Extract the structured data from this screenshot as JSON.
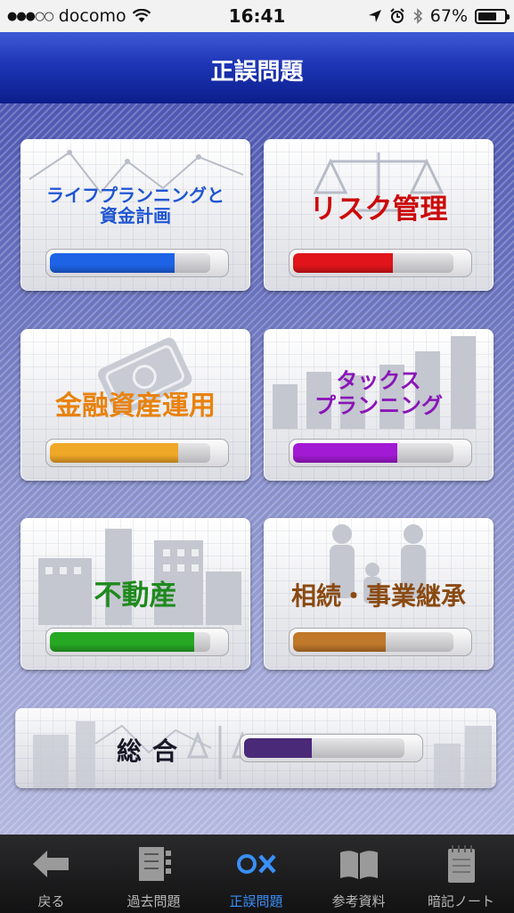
{
  "status_bar": {
    "carrier": "docomo",
    "time": "16:41",
    "battery": "67%",
    "icons": [
      "signal-dots-icon",
      "wifi-icon",
      "location-arrow-icon",
      "alarm-icon",
      "bluetooth-icon",
      "battery-icon"
    ]
  },
  "header": {
    "title": "正誤問題"
  },
  "categories": [
    {
      "label_line1": "ライフプランニングと",
      "label_line2": "資金計画",
      "color": "#1f55d2",
      "bar_color": "#1e63e6",
      "progress": 0.78
    },
    {
      "label_line1": "リスク管理",
      "label_line2": "",
      "color": "#cc0a0a",
      "bar_color": "#e0141a",
      "progress": 0.62
    },
    {
      "label_line1": "金融資産運用",
      "label_line2": "",
      "color": "#e8820e",
      "bar_color": "#f0a828",
      "progress": 0.8
    },
    {
      "label_line1": "タックス",
      "label_line2": "プランニング",
      "color": "#8a15b8",
      "bar_color": "#a21ad4",
      "progress": 0.65
    },
    {
      "label_line1": "不動産",
      "label_line2": "",
      "color": "#1e8a1c",
      "bar_color": "#26a824",
      "progress": 0.9
    },
    {
      "label_line1": "相続・事業継承",
      "label_line2": "",
      "color": "#8a4a12",
      "bar_color": "#c0782a",
      "progress": 0.58
    }
  ],
  "overall": {
    "label": "総合",
    "bar_color": "#4a2a78",
    "progress": 0.42
  },
  "tabs": [
    {
      "label": "戻る",
      "icon": "back-arrow-icon",
      "active": false
    },
    {
      "label": "過去問題",
      "icon": "book-list-icon",
      "active": false
    },
    {
      "label": "正誤問題",
      "icon": "circle-cross-icon",
      "active": true
    },
    {
      "label": "参考資料",
      "icon": "open-book-icon",
      "active": false
    },
    {
      "label": "暗記ノート",
      "icon": "notepad-icon",
      "active": false
    }
  ],
  "colors": {
    "header_blue": "#1e36b6",
    "tab_active": "#3a8ff6",
    "tab_inactive": "#b8b8b8"
  }
}
